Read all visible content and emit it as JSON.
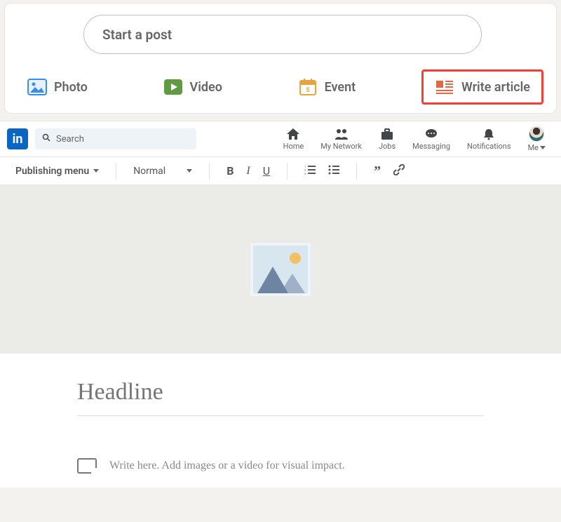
{
  "postCard": {
    "startPlaceholder": "Start a post",
    "actions": [
      {
        "key": "photo",
        "label": "Photo"
      },
      {
        "key": "video",
        "label": "Video"
      },
      {
        "key": "event",
        "label": "Event"
      },
      {
        "key": "write-article",
        "label": "Write article",
        "highlighted": true
      }
    ]
  },
  "nav": {
    "searchPlaceholder": "Search",
    "items": {
      "home": "Home",
      "network": "My Network",
      "jobs": "Jobs",
      "messaging": "Messaging",
      "notifications": "Notifications",
      "me": "Me"
    }
  },
  "toolbar": {
    "publishingMenu": "Publishing menu",
    "styleSelect": "Normal",
    "bold": "B",
    "italic": "I",
    "underline": "U",
    "quote": "”"
  },
  "editor": {
    "headlinePlaceholder": "Headline",
    "bodyPlaceholder": "Write here. Add images or a video for visual impact."
  }
}
